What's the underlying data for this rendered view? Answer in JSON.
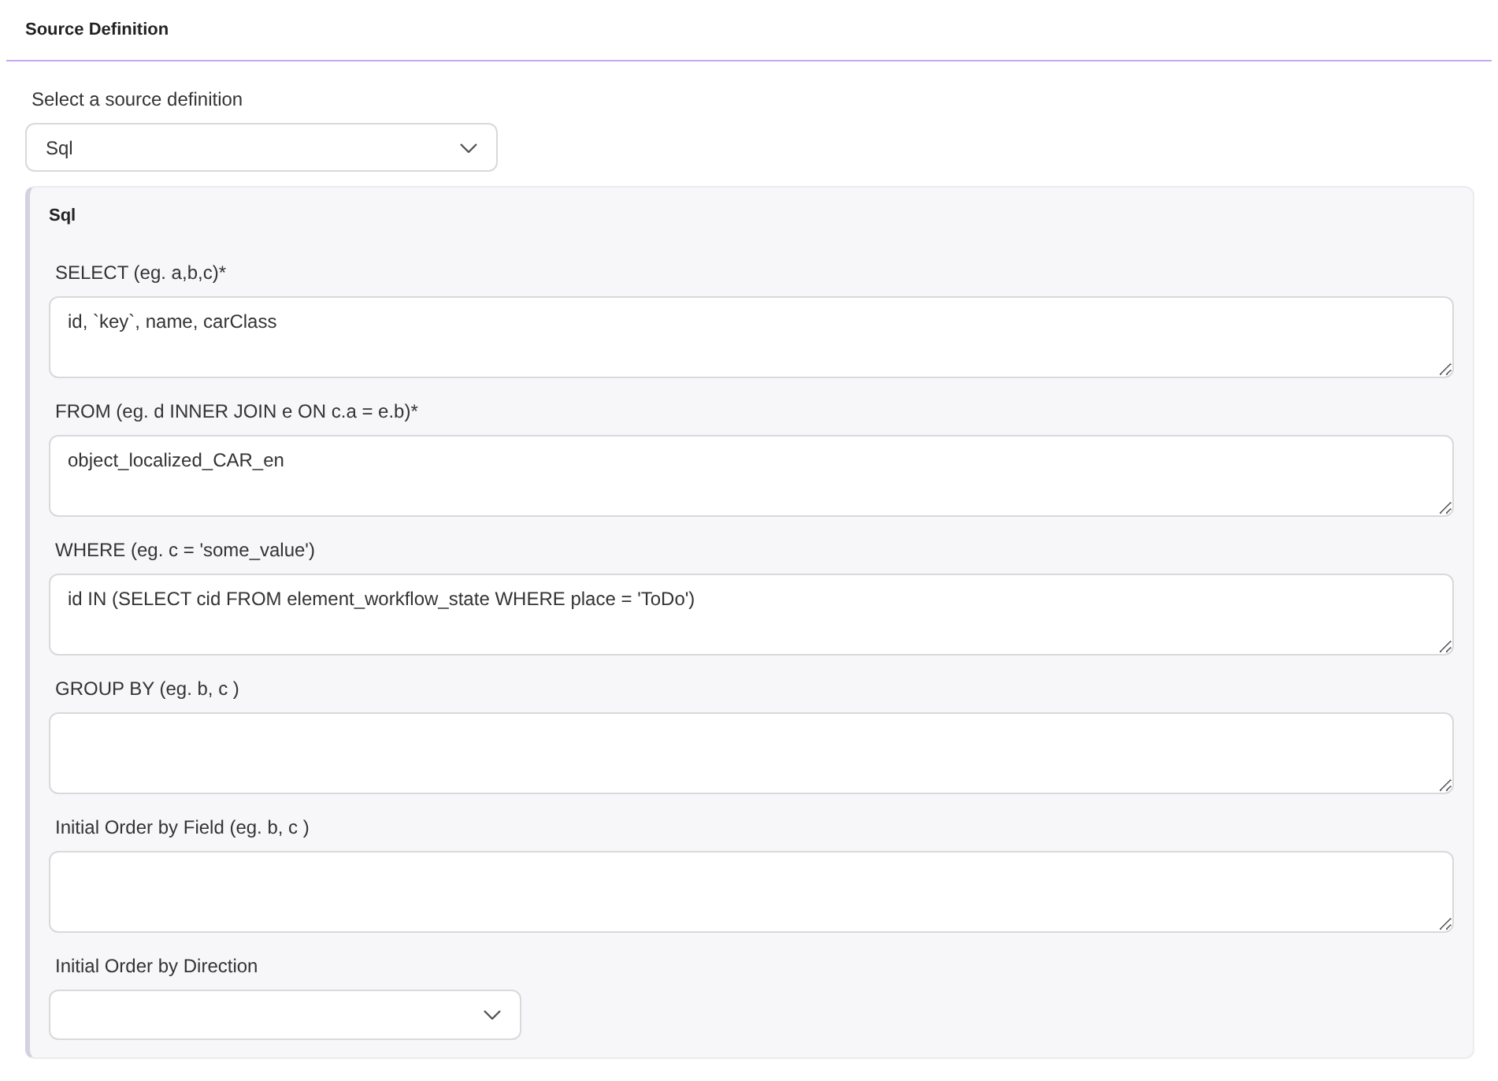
{
  "header": {
    "title": "Source Definition"
  },
  "source_select": {
    "label": "Select a source definition",
    "value": "Sql"
  },
  "panel": {
    "title": "Sql",
    "fields": [
      {
        "kind": "textarea",
        "label": "SELECT (eg. a,b,c)*",
        "value": "id, `key`, name, carClass"
      },
      {
        "kind": "textarea",
        "label": "FROM (eg. d INNER JOIN e ON c.a = e.b)*",
        "value": "object_localized_CAR_en"
      },
      {
        "kind": "textarea",
        "label": "WHERE (eg. c = 'some_value')",
        "value": "id IN (SELECT cid FROM element_workflow_state WHERE place = 'ToDo')"
      },
      {
        "kind": "textarea",
        "label": "GROUP BY (eg. b, c )"
      },
      {
        "kind": "textarea",
        "label": "Initial Order by Field (eg. b, c )"
      },
      {
        "kind": "select",
        "label": "Initial Order by Direction"
      }
    ]
  }
}
